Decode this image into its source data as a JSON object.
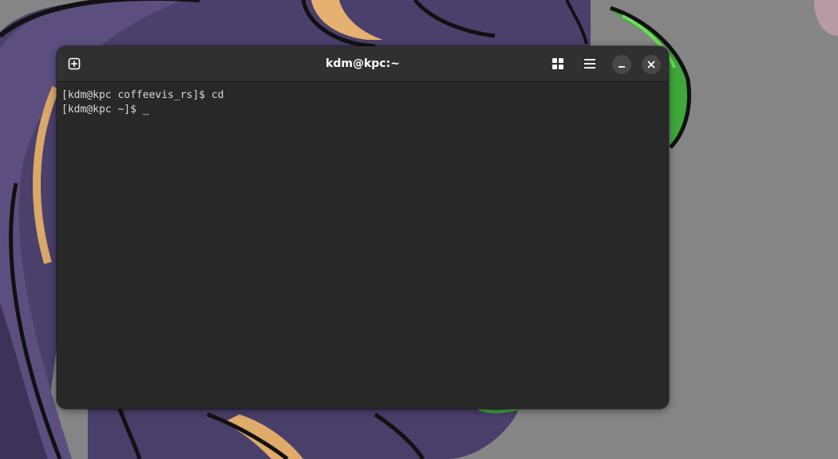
{
  "window": {
    "title": "kdm@kpc:~"
  },
  "headerbar": {
    "new_tab_icon": "tab-new-icon",
    "overview_icon": "view-grid-icon",
    "menu_icon": "hamburger-menu-icon",
    "minimize_icon": "minimize-icon",
    "close_icon": "close-icon"
  },
  "terminal": {
    "lines": [
      {
        "prompt": "[kdm@kpc coffeevis_rs]$ ",
        "command": "cd"
      },
      {
        "prompt": "[kdm@kpc ~]$ ",
        "command": ""
      }
    ],
    "cursor": "_"
  },
  "colors": {
    "window_bg": "#282828",
    "headerbar_bg": "#303030",
    "text": "#d8d8d8"
  }
}
